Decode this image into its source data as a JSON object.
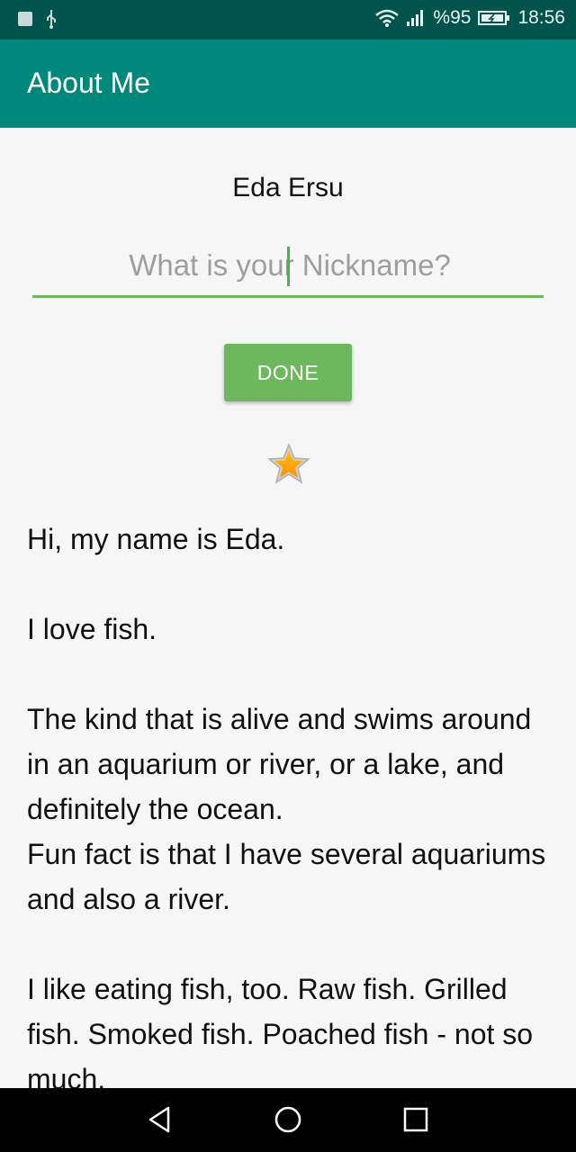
{
  "status_bar": {
    "battery": "%95",
    "time": "18:56",
    "icons": [
      "notification-square-icon",
      "usb-icon",
      "wifi-icon",
      "signal-icon",
      "battery-icon"
    ]
  },
  "app_bar": {
    "title": "About Me"
  },
  "profile": {
    "name": "Eda Ersu",
    "nickname_placeholder": "What is your Nickname?",
    "nickname_value": "",
    "done_label": "DONE"
  },
  "bio_text": "Hi, my name is Eda.\n\nI love fish.\n\nThe kind that is alive and swims around in an aquarium or river, or a lake, and definitely the ocean.\nFun fact is that I have several aquariums and also a river.\n\nI like eating fish, too. Raw fish. Grilled fish. Smoked fish. Poached fish - not so much.",
  "colors": {
    "status_bar": "#00544c",
    "app_bar": "#00897b",
    "accent_green": "#6db85c",
    "star_fill": "#ff9800"
  },
  "nav_bar": {
    "icons": [
      "back-icon",
      "home-icon",
      "recents-icon"
    ]
  }
}
